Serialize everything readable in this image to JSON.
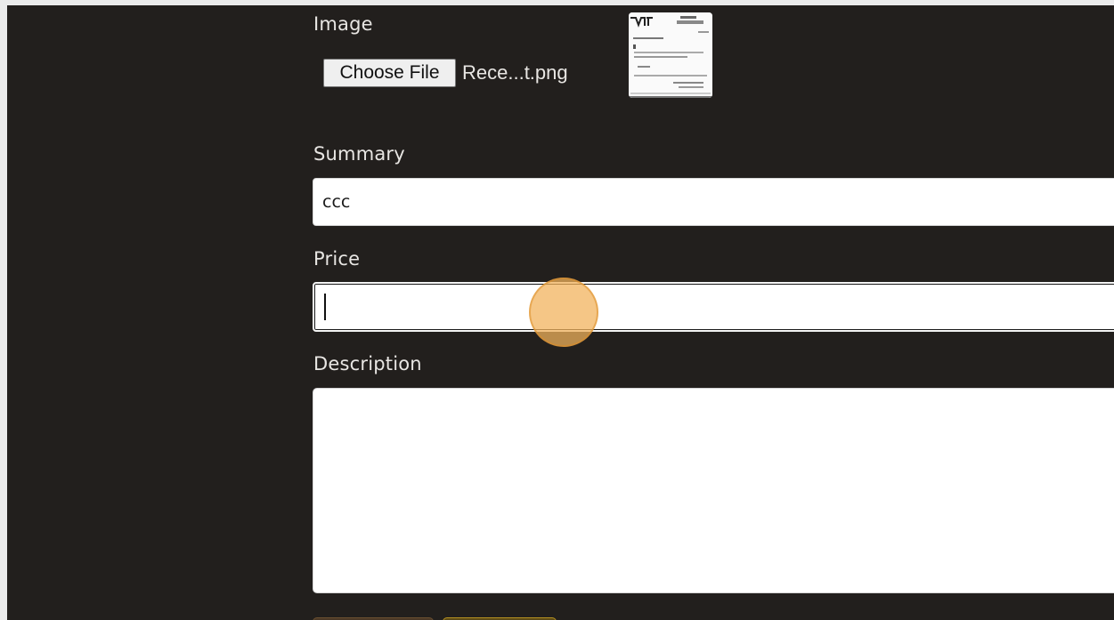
{
  "form": {
    "image": {
      "label": "Image",
      "choose_button_label": "Choose File",
      "file_name": "Rece...t.png",
      "thumbnail_icon": "receipt-thumbnail"
    },
    "summary": {
      "label": "Summary",
      "value": "ccc"
    },
    "price": {
      "label": "Price",
      "value": ""
    },
    "description": {
      "label": "Description",
      "value": ""
    }
  },
  "colors": {
    "page_background": "#221f1d",
    "outer_background": "#ebebeb",
    "label_text": "#e8e6e3",
    "input_background": "#ffffff",
    "click_marker": "#f2b25c"
  }
}
